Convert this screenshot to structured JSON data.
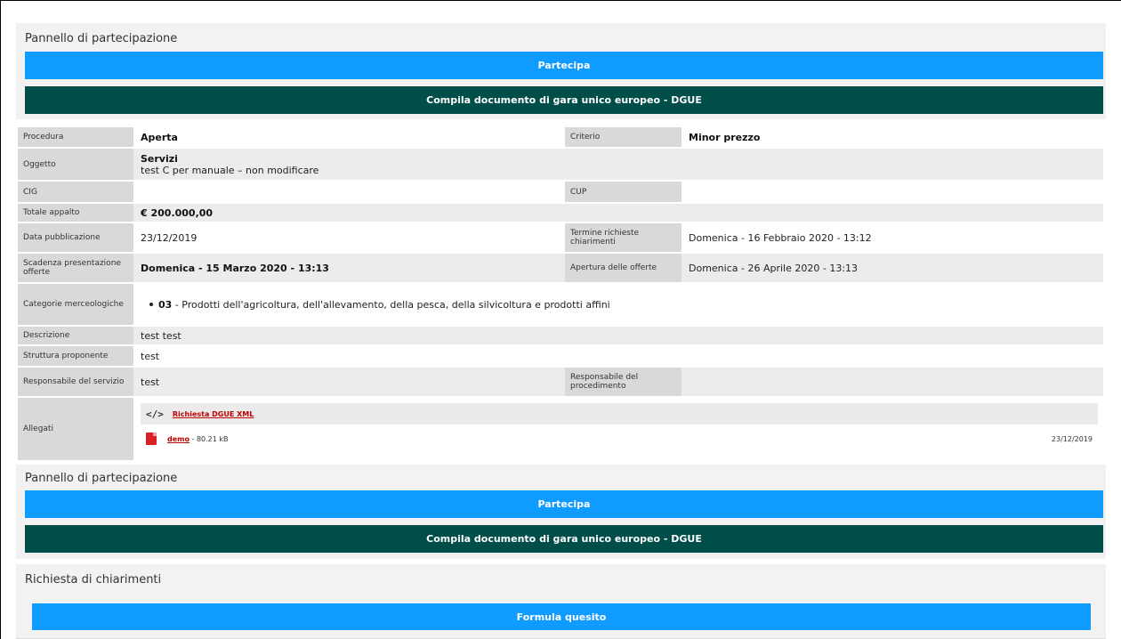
{
  "panel_top": {
    "title": "Pannello di partecipazione",
    "participate_label": "Partecipa",
    "dgue_label": "Compila documento di gara unico europeo - DGUE"
  },
  "details": {
    "procedura_label": "Procedura",
    "procedura_value": "Aperta",
    "criterio_label": "Criterio",
    "criterio_value": "Minor prezzo",
    "oggetto_label": "Oggetto",
    "oggetto_title": "Servizi",
    "oggetto_desc": "test C per manuale – non modificare",
    "cig_label": "CIG",
    "cig_value": "",
    "cup_label": "CUP",
    "cup_value": "",
    "totale_label": "Totale appalto",
    "totale_value": "€ 200.000,00",
    "data_pub_label": "Data pubblicazione",
    "data_pub_value": "23/12/2019",
    "termine_label": "Termine richieste chiarimenti",
    "termine_value": "Domenica - 16 Febbraio 2020 - 13:12",
    "scadenza_label": "Scadenza presentazione offerte",
    "scadenza_value": "Domenica - 15 Marzo 2020 - 13:13",
    "apertura_label": "Apertura delle offerte",
    "apertura_value": "Domenica - 26 Aprile 2020 - 13:13",
    "categorie_label": "Categorie merceologiche",
    "categorie_code": "03",
    "categorie_text": " - Prodotti dell'agricoltura, dell'allevamento, della pesca, della silvicoltura e prodotti affini",
    "descrizione_label": "Descrizione",
    "descrizione_value": "test test",
    "struttura_label": "Struttura proponente",
    "struttura_value": "test",
    "resp_servizio_label": "Responsabile del servizio",
    "resp_servizio_value": "test",
    "resp_proc_label": "Responsabile del procedimento",
    "resp_proc_value": "",
    "allegati_label": "Allegati",
    "xml_icon_glyph": "</>",
    "xml_link": "Richiesta DGUE XML",
    "pdf_link": "demo",
    "pdf_size": " - 80.21 kB",
    "pdf_date": "23/12/2019"
  },
  "panel_bottom": {
    "title": "Pannello di partecipazione",
    "participate_label": "Partecipa",
    "dgue_label": "Compila documento di gara unico europeo - DGUE"
  },
  "chiarimenti": {
    "title": "Richiesta di chiarimenti",
    "formula_label": "Formula quesito"
  },
  "colors": {
    "primary_blue": "#0f9bff",
    "dgue_green": "#004e4a",
    "link_red": "#c00000"
  }
}
